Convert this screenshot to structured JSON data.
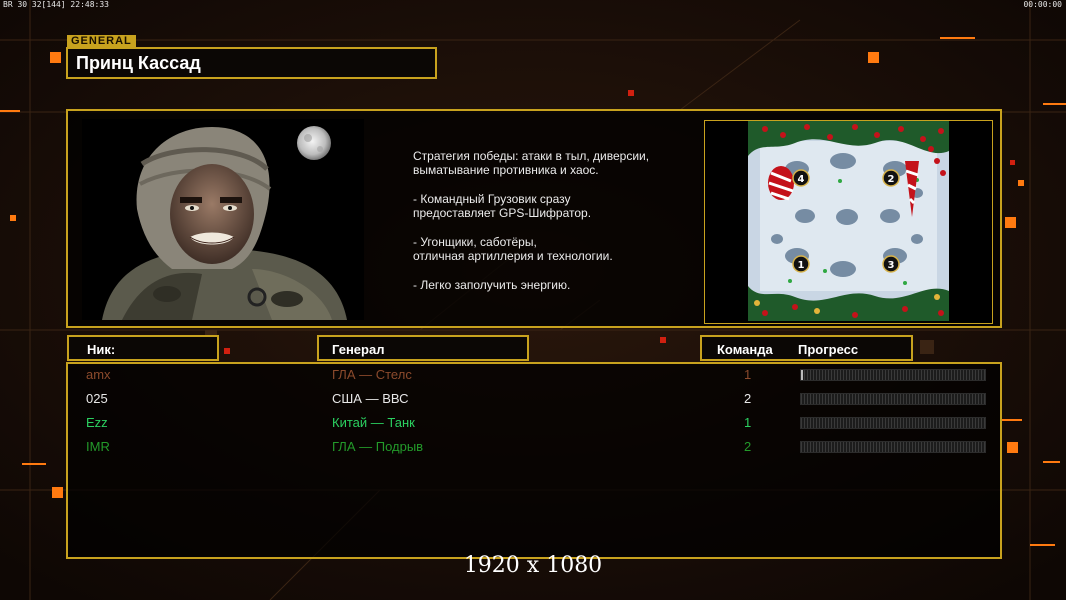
{
  "hud": {
    "left": "BR 30 32[144] 22:48:33",
    "right": "00:00:00"
  },
  "general": {
    "tag": "GENERAL",
    "name": "Принц Кассад"
  },
  "description": {
    "lines": [
      "Стратегия победы: атаки в тыл, диверсии,\n выматывание противника и хаос.",
      "- Командный Грузовик сразу\nпредоставляет GPS-Шифратор.",
      "- Угонщики, саботёры,\nотличная артиллерия и технологии.",
      "- Легко заполучить энергию."
    ]
  },
  "map": {
    "start_positions": [
      "4",
      "2",
      "1",
      "3"
    ]
  },
  "headers": {
    "nick": "Ник:",
    "general": "Генерал",
    "team": "Команда",
    "progress": "Прогресс"
  },
  "players": [
    {
      "nick": "amx",
      "general": "ГЛА — Стелс",
      "team": "1",
      "color": "#8b4a2c",
      "progress": 0.01
    },
    {
      "nick": "025",
      "general": "США — ВВС",
      "team": "2",
      "color": "#e8e8e8",
      "progress": 0
    },
    {
      "nick": "Ezz",
      "general": "Китай — Танк",
      "team": "1",
      "color": "#2bd060",
      "progress": 0
    },
    {
      "nick": "IMR",
      "general": "ГЛА — Подрыв",
      "team": "2",
      "color": "#239a2a",
      "progress": 0
    }
  ],
  "resolution_label": "1920 x 1080"
}
